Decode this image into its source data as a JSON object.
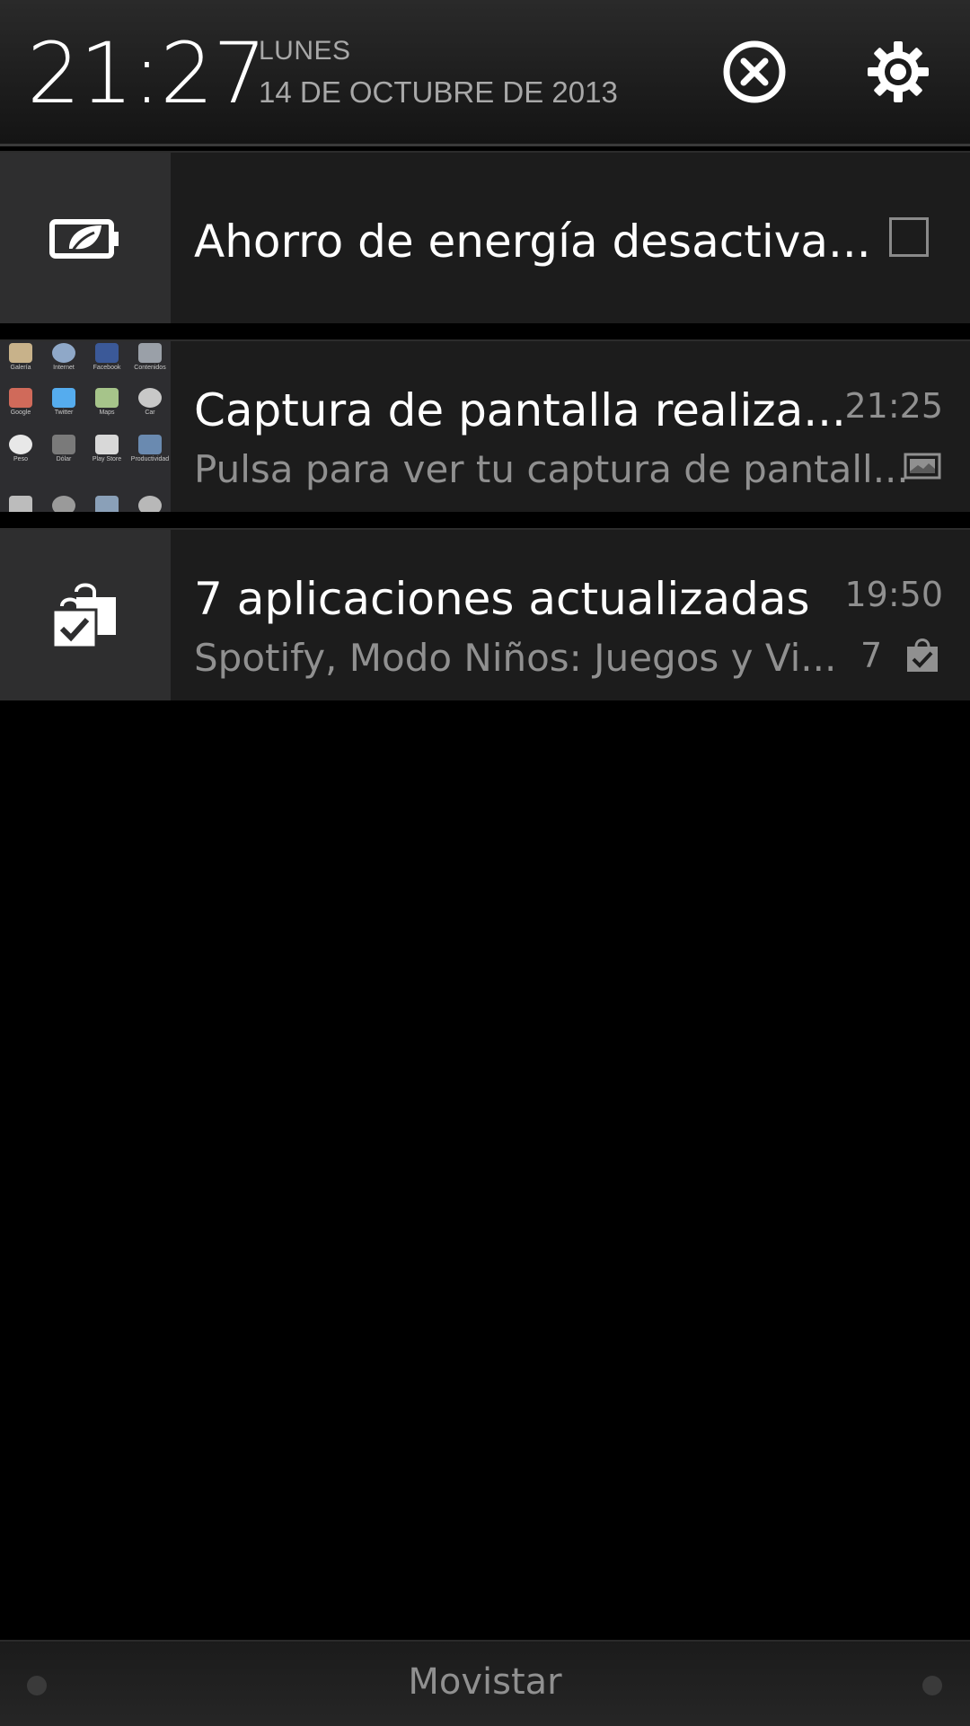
{
  "header": {
    "time": "21:27",
    "weekday": "LUNES",
    "date": "14 DE OCTUBRE DE 2013",
    "clear_icon": "clear-all-icon",
    "settings_icon": "gear-icon"
  },
  "notifications": [
    {
      "icon": "battery-leaf-icon",
      "title": "Ahorro de energía desactiva...",
      "checkbox_checked": false
    },
    {
      "icon": "screenshot-thumbnail",
      "title": "Captura de pantalla realiza...",
      "subtitle": "Pulsa para ver tu captura de pantall...",
      "time": "21:25",
      "small_icon": "image-icon",
      "thumbnail_labels": [
        "Galería",
        "Internet",
        "Facebook",
        "Contenidos",
        "Google",
        "Twitter",
        "Maps",
        "Car",
        "Peso",
        "Dólar",
        "Play Store",
        "Productividad"
      ]
    },
    {
      "icon": "shopping-bag-check-icon",
      "title": "7 aplicaciones actualizadas",
      "subtitle": "Spotify, Modo Niños: Juegos y Vi...",
      "time": "19:50",
      "count": "7",
      "small_icon": "shopping-bag-check-icon"
    }
  ],
  "footer": {
    "carrier": "Movistar"
  }
}
